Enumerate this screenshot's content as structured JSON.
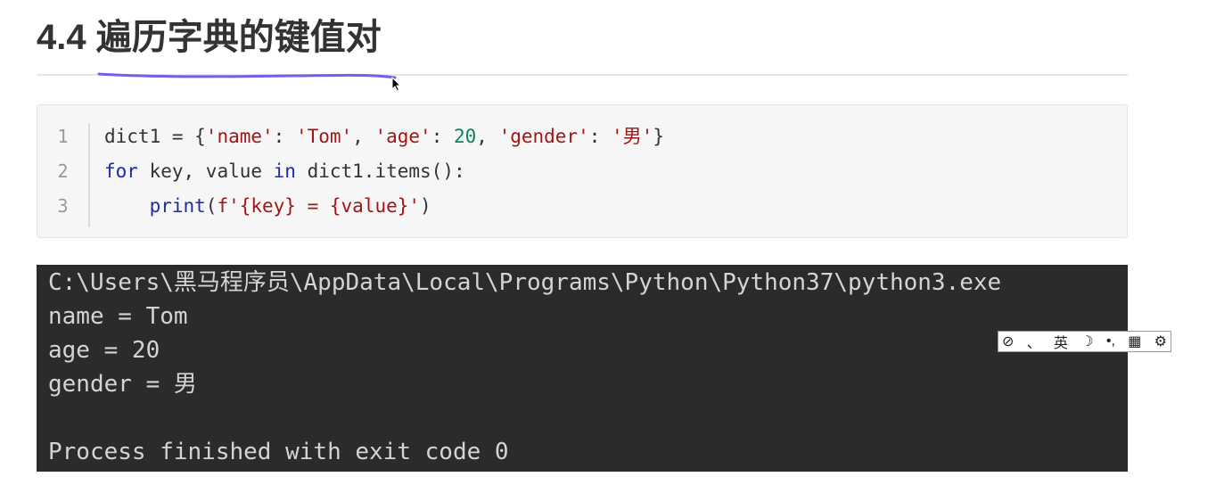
{
  "heading": {
    "number": "4.4",
    "title": "遍历字典的键值对"
  },
  "code": {
    "line_numbers": [
      "1",
      "2",
      "3"
    ],
    "lines": [
      {
        "tokens": [
          {
            "text": "dict1 = {",
            "style": "p"
          },
          {
            "text": "'name'",
            "style": "s"
          },
          {
            "text": ": ",
            "style": "p"
          },
          {
            "text": "'Tom'",
            "style": "s"
          },
          {
            "text": ", ",
            "style": "p"
          },
          {
            "text": "'age'",
            "style": "s"
          },
          {
            "text": ": ",
            "style": "p"
          },
          {
            "text": "20",
            "style": "n"
          },
          {
            "text": ", ",
            "style": "p"
          },
          {
            "text": "'gender'",
            "style": "s"
          },
          {
            "text": ": ",
            "style": "p"
          },
          {
            "text": "'男'",
            "style": "s"
          },
          {
            "text": "}",
            "style": "p"
          }
        ]
      },
      {
        "tokens": [
          {
            "text": "for",
            "style": "k"
          },
          {
            "text": " key, value ",
            "style": "p"
          },
          {
            "text": "in",
            "style": "k"
          },
          {
            "text": " dict1.items():",
            "style": "p"
          }
        ]
      },
      {
        "tokens": [
          {
            "text": "    ",
            "style": "p"
          },
          {
            "text": "print",
            "style": "k"
          },
          {
            "text": "(",
            "style": "p"
          },
          {
            "text": "f'{key} = {value}'",
            "style": "s"
          },
          {
            "text": ")",
            "style": "p"
          }
        ]
      }
    ]
  },
  "terminal": {
    "lines": [
      "C:\\Users\\黑马程序员\\AppData\\Local\\Programs\\Python\\Python37\\python3.exe",
      "name = Tom",
      "age = 20",
      "gender = 男",
      "",
      "Process finished with exit code 0"
    ]
  },
  "ime_toolbar": {
    "items": [
      {
        "icon": "ime-logo-icon",
        "label": "⊘"
      },
      {
        "icon": "separator-dot",
        "label": "、"
      },
      {
        "icon": "language-indicator",
        "label": "英"
      },
      {
        "icon": "moon-icon",
        "label": "☽"
      },
      {
        "icon": "punctuation-icon",
        "label": "•,"
      },
      {
        "icon": "keyboard-icon",
        "label": "▦"
      },
      {
        "icon": "gear-icon",
        "label": "⚙"
      }
    ]
  },
  "colors": {
    "string": "#a31515",
    "number": "#098658",
    "keyword": "#1f2aa8",
    "terminal_bg": "#2b2b2b",
    "terminal_fg": "#d4d4d4",
    "pen_stroke": "#7b5ce6"
  }
}
